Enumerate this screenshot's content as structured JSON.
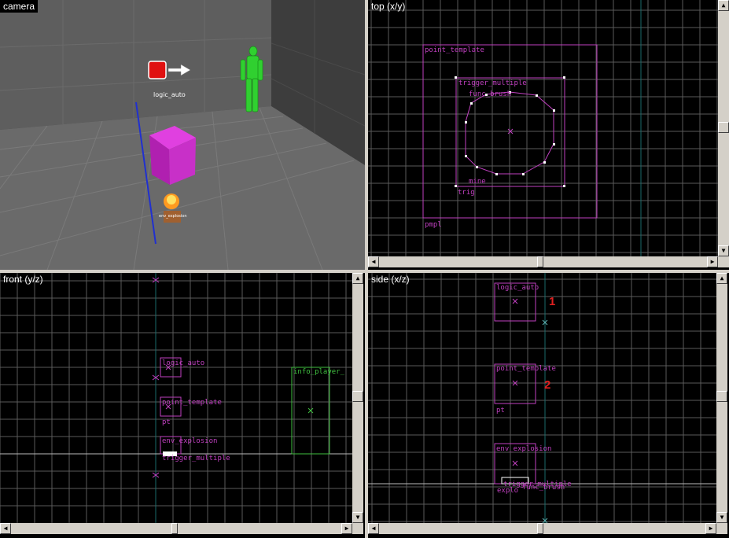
{
  "viewports": {
    "camera": {
      "title": "camera"
    },
    "top": {
      "title": "top (x/y)"
    },
    "front": {
      "title": "front (y/z)"
    },
    "side": {
      "title": "side (x/z)"
    }
  },
  "camera_scene": {
    "logic_label": "logic_auto",
    "explosion_label": "env_explosion"
  },
  "top_view": {
    "entities": [
      "point_template",
      "trigger_multiple",
      "func_brush",
      "mine",
      "trig",
      "pmpl"
    ]
  },
  "front_view": {
    "entities": [
      "logic_auto",
      "point_template",
      "pt",
      "env_explosion",
      "trigger_multiple",
      "info_player_"
    ]
  },
  "side_view": {
    "entities": [
      "logic_auto",
      "point_template",
      "pt",
      "env_explosion",
      "trigger_multiple",
      "func_brush",
      "explo"
    ],
    "markers": [
      "1",
      "2"
    ]
  },
  "colors": {
    "grid_bg": "#000000",
    "grid_line": "#5a5a5a",
    "entity": "#c040c0",
    "player": "#40c040",
    "axis": "#1a6a6a"
  },
  "icons": {
    "arrow_up": "▲",
    "arrow_down": "▼",
    "arrow_left": "◀",
    "arrow_right": "▶"
  }
}
